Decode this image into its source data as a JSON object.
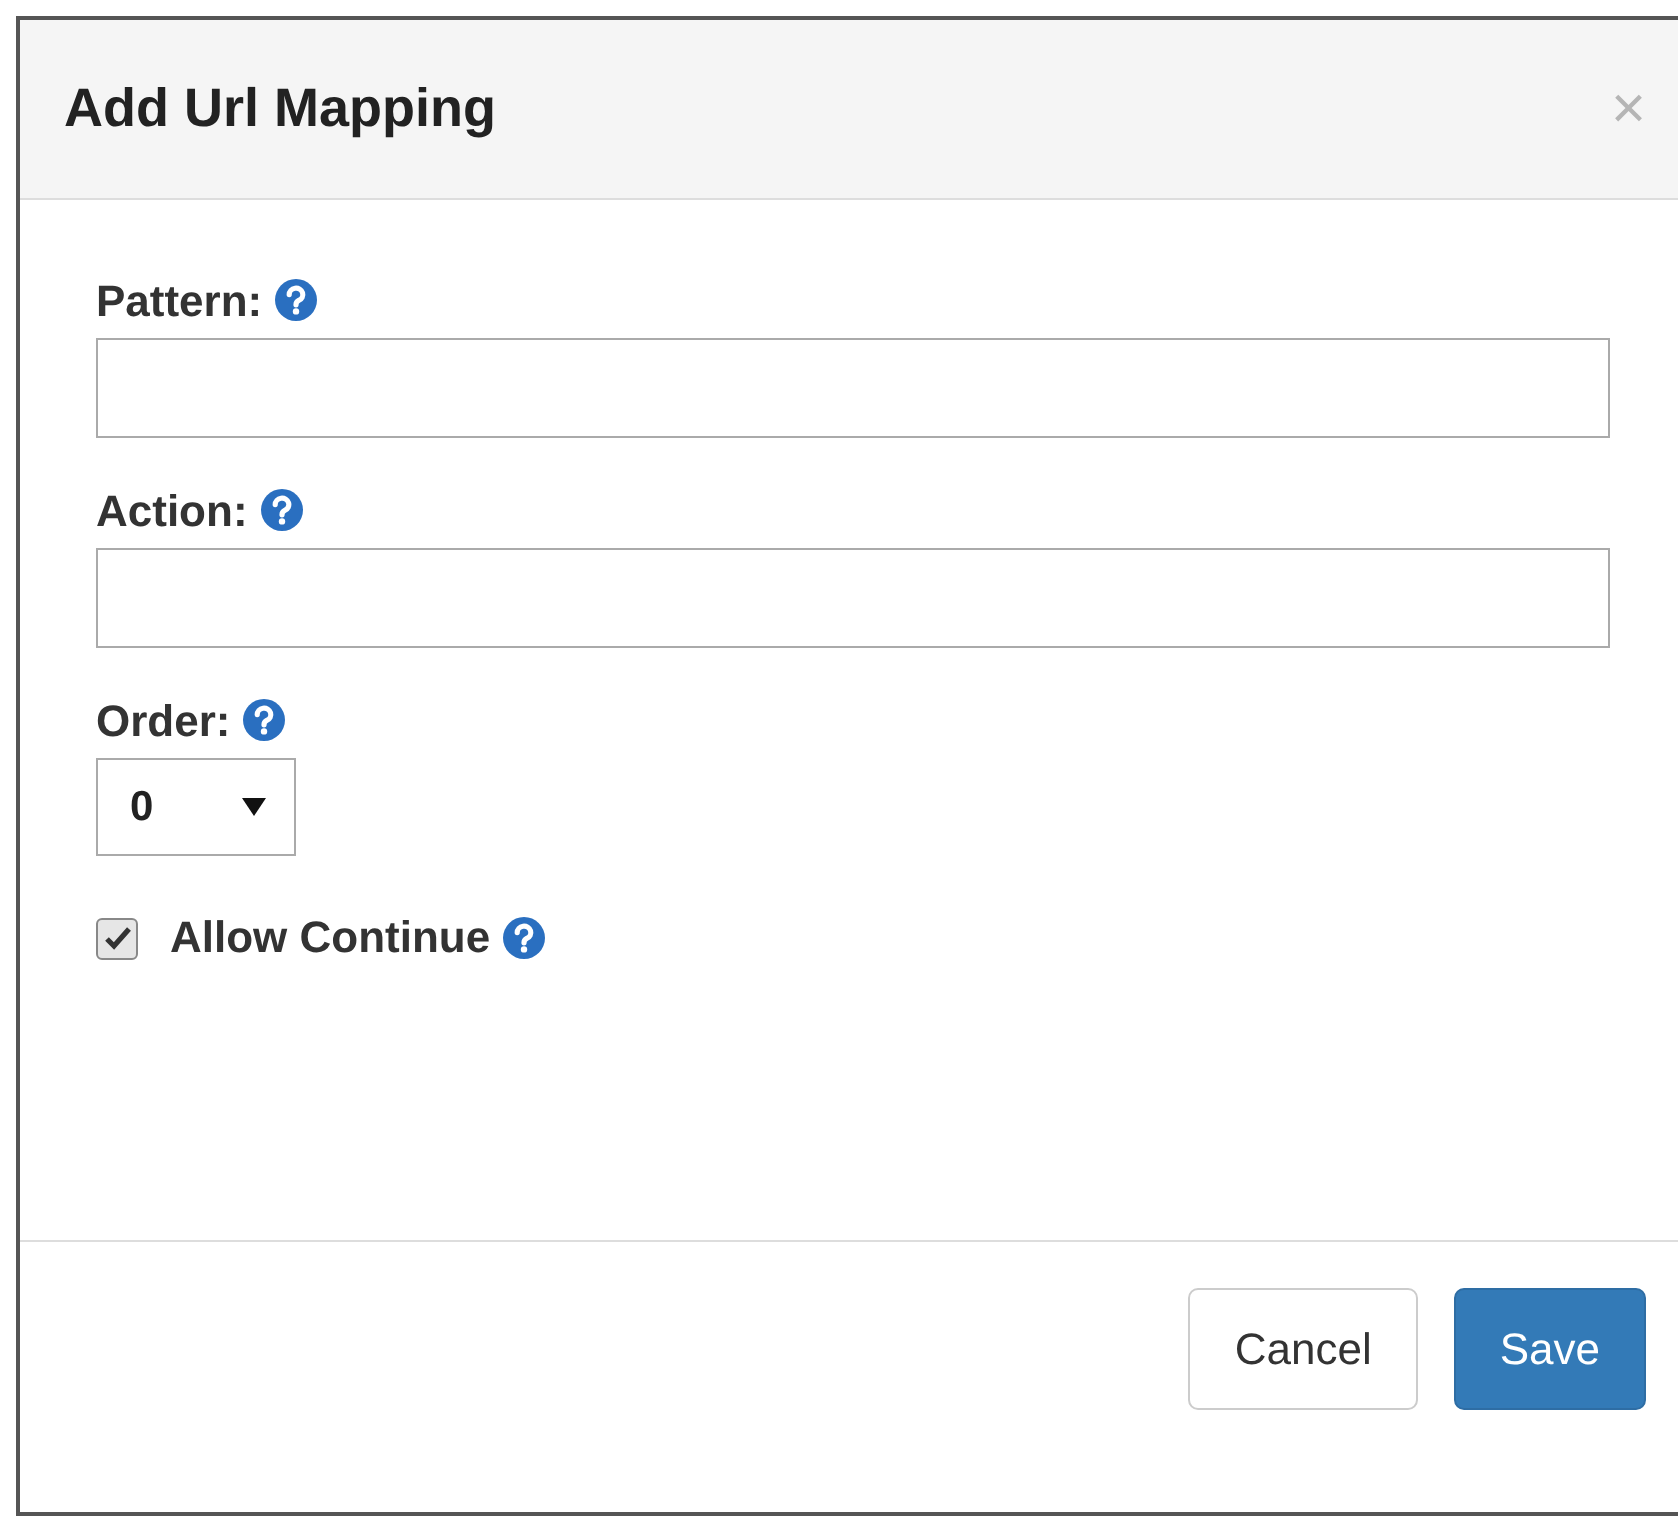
{
  "dialog": {
    "title": "Add Url Mapping",
    "close": "×"
  },
  "fields": [
    {
      "kind": "text",
      "label": "Pattern:",
      "help": true
    },
    {
      "kind": "text",
      "label": "Action:",
      "help": true
    },
    {
      "kind": "select",
      "label": "Order:",
      "help": true,
      "value": "0"
    },
    {
      "kind": "checkbox",
      "label": "Allow Continue",
      "help": true,
      "checked": true
    }
  ],
  "buttons": [
    {
      "kind": "default",
      "label": "Cancel"
    },
    {
      "kind": "primary",
      "label": "Save"
    }
  ]
}
